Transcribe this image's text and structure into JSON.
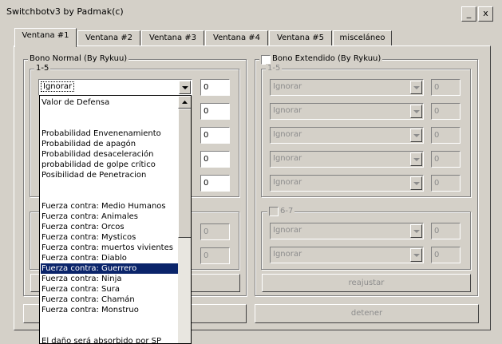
{
  "window": {
    "title": "Switchbotv3 by Padmak(c)",
    "minimize_label": "_",
    "close_label": "x"
  },
  "tabs": [
    {
      "label": "Ventana #1",
      "active": true
    },
    {
      "label": "Ventana #2"
    },
    {
      "label": "Ventana #3"
    },
    {
      "label": "Ventana #4"
    },
    {
      "label": "Ventana #5"
    },
    {
      "label": "misceláneo"
    }
  ],
  "left_group": {
    "title": "Bono Normal (By Rykuu)",
    "sub_title": "1-5",
    "dropdown_value": "Ignorar",
    "values": [
      "0",
      "0",
      "0",
      "0",
      "0"
    ],
    "lower_values": [
      "0",
      "0"
    ]
  },
  "right_group": {
    "title": "Bono Extendido (By Rykuu)",
    "sub_title": "1-5",
    "dropdowns": [
      "Ignorar",
      "Ignorar",
      "Ignorar",
      "Ignorar",
      "Ignorar"
    ],
    "values": [
      "0",
      "0",
      "0",
      "0",
      "0"
    ],
    "group2_title": "6-7",
    "group2_dropdowns": [
      "Ignorar",
      "Ignorar"
    ],
    "group2_values": [
      "0",
      "0"
    ],
    "reajustar_label": "reajustar"
  },
  "detener_label": "detener",
  "dropdown_list": [
    "Valor de Defensa",
    "",
    "",
    "Probabilidad Envenenamiento",
    "Probabilidad de apagón",
    "Probabilidad desaceleración",
    "probabilidad de golpe crítico",
    "Posibilidad de Penetracion",
    "",
    "",
    "Fuerza contra: Medio Humanos",
    "Fuerza contra: Animales",
    "Fuerza contra: Orcos",
    "Fuerza contra: Mysticos",
    "Fuerza contra: muertos vivientes",
    "Fuerza contra: Diablo",
    "Fuerza contra: Guerrero",
    "Fuerza contra: Ninja",
    "Fuerza contra: Sura",
    "Fuerza contra: Chamán",
    "Fuerza contra: Monstruo",
    "",
    "",
    "El daño será absorbido por SP"
  ],
  "selected_index": 16
}
